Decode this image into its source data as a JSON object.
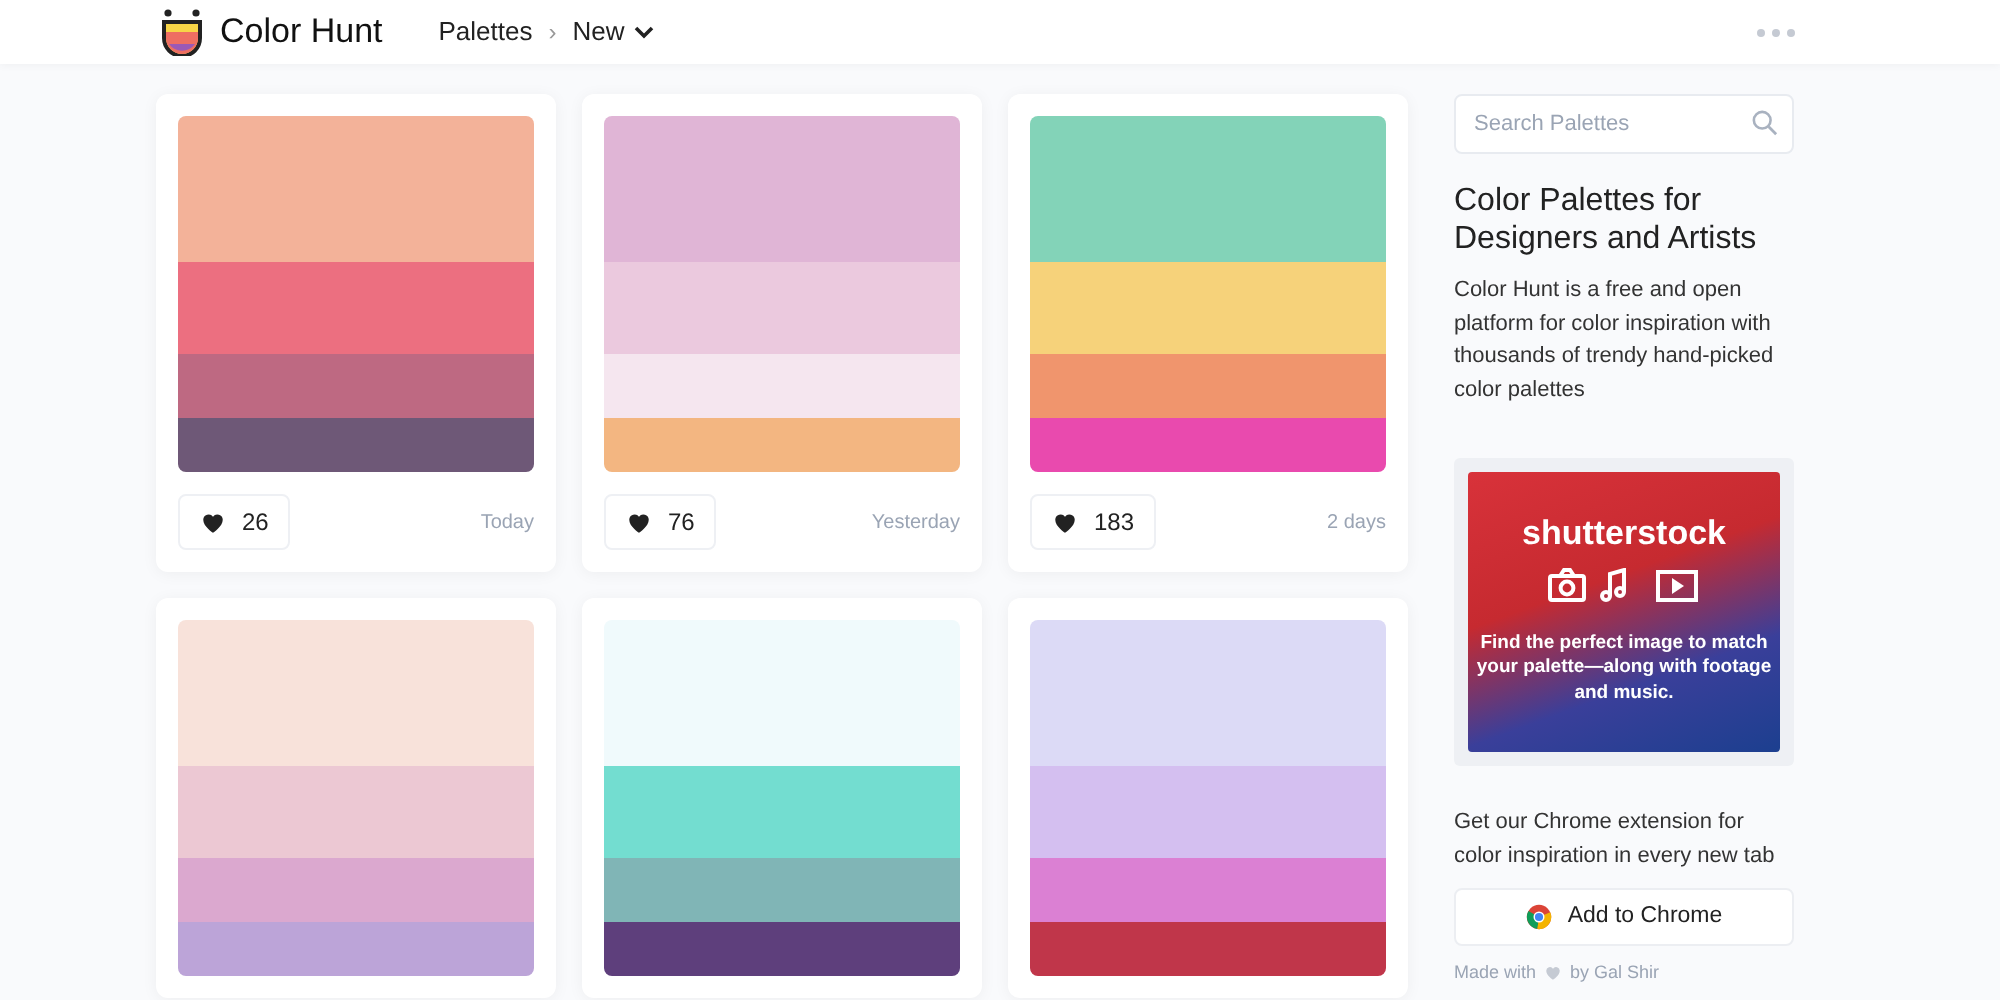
{
  "header": {
    "brand": "Color Hunt",
    "separator": "›",
    "breadcrumb": [
      {
        "label": "Palettes"
      },
      {
        "label": "New",
        "dropdown": true
      }
    ]
  },
  "palettes": [
    {
      "stripes": [
        {
          "color": "#f3b299"
        },
        {
          "color": "#ec6f80"
        },
        {
          "color": "#be6982"
        },
        {
          "color": "#6e5877"
        }
      ],
      "likes": "26",
      "date": "Today"
    },
    {
      "stripes": [
        {
          "color": "#e0b5d6"
        },
        {
          "color": "#ebc9de"
        },
        {
          "color": "#f5e6ef"
        },
        {
          "color": "#f3b681"
        }
      ],
      "likes": "76",
      "date": "Yesterday"
    },
    {
      "stripes": [
        {
          "color": "#83d3b8"
        },
        {
          "color": "#f6d27a"
        },
        {
          "color": "#f0956d"
        },
        {
          "color": "#e94aae"
        }
      ],
      "likes": "183",
      "date": "2 days"
    },
    {
      "stripes": [
        {
          "color": "#f8e2da"
        },
        {
          "color": "#ecc8d3"
        },
        {
          "color": "#dba8cf"
        },
        {
          "color": "#bca4d8"
        }
      ]
    },
    {
      "stripes": [
        {
          "color": "#f0fafc"
        },
        {
          "color": "#73ddd0"
        },
        {
          "color": "#80b5b6"
        },
        {
          "color": "#5e3f7c"
        }
      ]
    },
    {
      "stripes": [
        {
          "color": "#dcdaf6"
        },
        {
          "color": "#d4bff0"
        },
        {
          "color": "#db80d3"
        },
        {
          "color": "#c0364a"
        }
      ]
    }
  ],
  "sidebar": {
    "search": {
      "placeholder": "Search Palettes"
    },
    "title": "Color Palettes for Designers and Artists",
    "description": "Color Hunt is a free and open platform for color inspiration with thousands of trendy hand-picked color palettes",
    "ad": {
      "brand": "shutterstock",
      "text": "Find the perfect image to match your palette—along with footage and music."
    },
    "extension_text": "Get our Chrome extension for color inspiration in every new tab",
    "extension_button": "Add to Chrome",
    "footer": [
      "Made with",
      "by Gal Shir"
    ]
  }
}
